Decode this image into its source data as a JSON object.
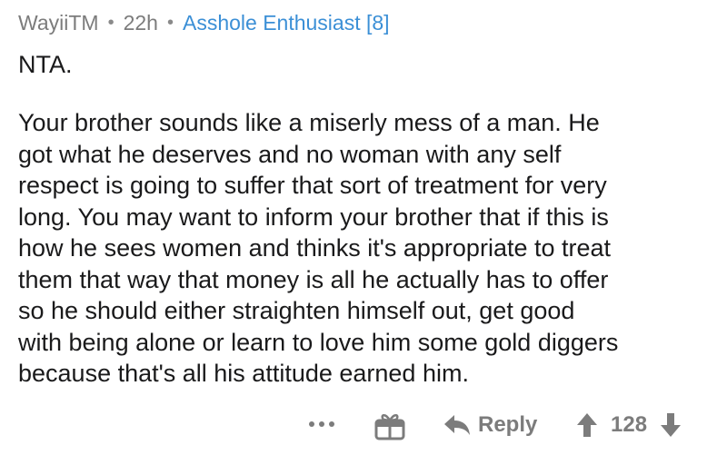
{
  "comment": {
    "author": "WayiiTM",
    "separator": "•",
    "age": "22h",
    "flair": "Asshole Enthusiast [8]",
    "verdict": "NTA.",
    "body_lines": [
      "Your brother sounds like a miserly mess of a man.  He",
      "got what he deserves and no woman with any self",
      "respect is going to suffer that sort of treatment for very",
      "long.  You may want to inform your brother that if this is",
      "how he sees women and thinks it's appropriate to treat",
      "them that way that money is all he actually has to offer",
      "so he should either straighten himself out, get good",
      "with being alone or learn to love him some gold diggers",
      "because that's all his attitude earned him."
    ]
  },
  "actions": {
    "more_icon": "more-dots-icon",
    "award_icon": "award-gift-icon",
    "reply_icon": "reply-arrow-icon",
    "reply_label": "Reply",
    "upvote_icon": "upvote-arrow-icon",
    "score": "128",
    "downvote_icon": "downvote-arrow-icon"
  },
  "colors": {
    "text": "#1a1a1b",
    "meta": "#7c7c7c",
    "flair": "#3b8fd6",
    "icons": "#7c7c7c",
    "background": "#ffffff"
  }
}
